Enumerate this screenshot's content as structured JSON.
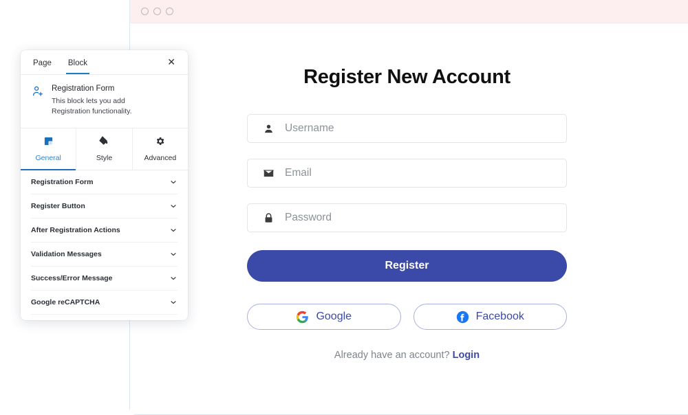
{
  "browser": {
    "titlebar": {
      "dots": [
        "dot-1",
        "dot-2",
        "dot-3"
      ]
    }
  },
  "form": {
    "title": "Register New Account",
    "fields": [
      {
        "icon": "person-icon",
        "placeholder": "Username",
        "value": ""
      },
      {
        "icon": "envelope-icon",
        "placeholder": "Email",
        "value": ""
      },
      {
        "icon": "lock-icon",
        "placeholder": "Password",
        "value": ""
      }
    ],
    "submit_label": "Register",
    "social": [
      {
        "label": "Google",
        "icon": "google-icon"
      },
      {
        "label": "Facebook",
        "icon": "facebook-icon"
      }
    ],
    "footer_text": "Already have an account?",
    "footer_link": "Login"
  },
  "panel": {
    "tabs": [
      {
        "label": "Page",
        "active": false
      },
      {
        "label": "Block",
        "active": true
      }
    ],
    "close_label": "✕",
    "block": {
      "icon": "person-add-icon",
      "title": "Registration Form",
      "description": "This block lets you add Registration functionality."
    },
    "segments": [
      {
        "label": "General",
        "icon": "general-square-icon",
        "active": true
      },
      {
        "label": "Style",
        "icon": "paint-bucket-icon",
        "active": false
      },
      {
        "label": "Advanced",
        "icon": "gear-icon",
        "active": false
      }
    ],
    "accordion": [
      {
        "label": "Registration Form"
      },
      {
        "label": "Register Button"
      },
      {
        "label": "After Registration Actions"
      },
      {
        "label": "Validation Messages"
      },
      {
        "label": "Success/Error Message"
      },
      {
        "label": "Google reCAPTCHA"
      }
    ]
  },
  "colors": {
    "primary": "#3b4aa8",
    "accent_blue": "#1b6fbb",
    "titlebar_bg": "#fdeeef",
    "google_blue": "#4285f4",
    "google_red": "#ea4335",
    "google_yellow": "#fbbc05",
    "google_green": "#34a853",
    "facebook_blue": "#1877f2"
  }
}
